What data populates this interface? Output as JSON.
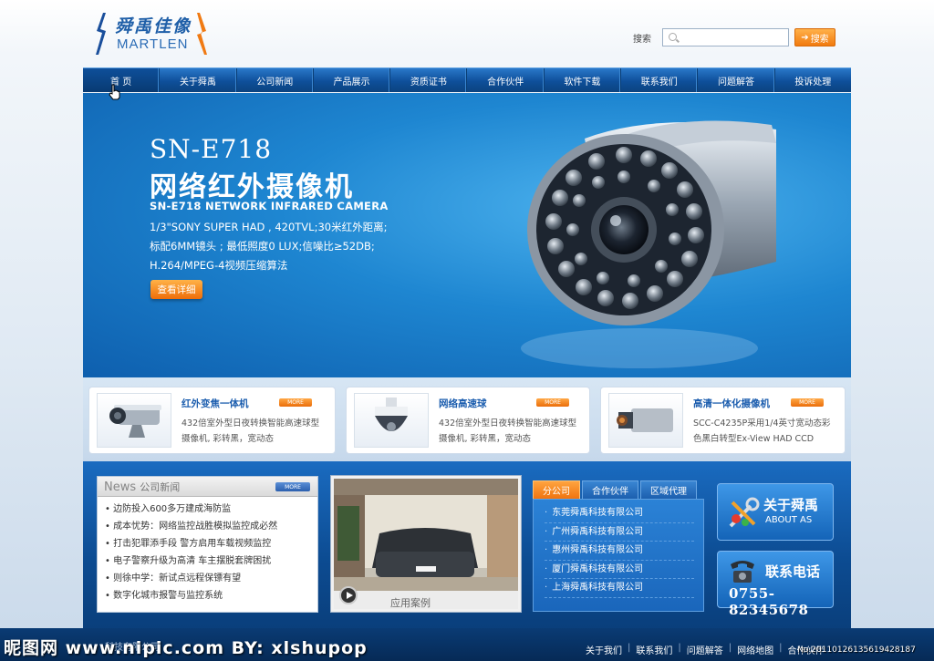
{
  "brand": {
    "name_cn": "舜禹佳像",
    "name_en": "MARTLEN"
  },
  "search": {
    "label": "搜索",
    "placeholder": "",
    "button": "搜索"
  },
  "nav": [
    {
      "label": "首 页"
    },
    {
      "label": "关于舜禹"
    },
    {
      "label": "公司新闻"
    },
    {
      "label": "产品展示"
    },
    {
      "label": "资质证书"
    },
    {
      "label": "合作伙伴"
    },
    {
      "label": "软件下载"
    },
    {
      "label": "联系我们"
    },
    {
      "label": "问题解答"
    },
    {
      "label": "投诉处理"
    }
  ],
  "banner": {
    "model": "SN-E718",
    "title": "网络红外摄像机",
    "title_en": "SN-E718 NETWORK INFRARED CAMERA",
    "desc": [
      "1/3\"SONY SUPER HAD , 420TVL;30米红外距离;",
      "标配6MM镜头 ; 最低照度0 LUX;信噪比≥52DB;",
      "H.264/MPEG-4视频压缩算法"
    ],
    "button": "查看详细"
  },
  "products": [
    {
      "title": "红外变焦一体机",
      "more": "MORE",
      "desc": "432倍室外型日夜转换智能高速球型摄像机, 彩转黑，宽动态"
    },
    {
      "title": "网络高速球",
      "more": "MORE",
      "desc": "432倍室外型日夜转换智能高速球型摄像机, 彩转黑，宽动态"
    },
    {
      "title": "高清一体化摄像机",
      "more": "MORE",
      "desc": "SCC-C4235P采用1/4英寸宽动态彩色黑白转型Ex-View HAD CCD"
    }
  ],
  "news": {
    "title_en": "News",
    "title_cn": "公司新闻",
    "more": "MORE",
    "items": [
      "边防投入600多万建成海防监",
      "成本忧势：网络监控战胜模拟监控成必然",
      "打击犯罪添手段 警方启用车载视频监控",
      "电子警察升级为高清 车主摆脱套牌困扰",
      "则徐中学：新试点远程保镖有望",
      "数字化城市报警与监控系统"
    ]
  },
  "case": {
    "caption": "应用案例"
  },
  "partners": {
    "tabs": [
      "分公司",
      "合作伙伴",
      "区域代理"
    ],
    "items": [
      "东莞舜禹科技有限公司",
      "广州舜禹科技有限公司",
      "惠州舜禹科技有限公司",
      "厦门舜禹科技有限公司",
      "上海舜禹科技有限公司"
    ]
  },
  "about": {
    "title": "关于舜禹",
    "subtitle": "ABOUT AS"
  },
  "contact": {
    "title": "联系电话",
    "phone": "0755-82345678"
  },
  "footer": {
    "copyright": "科技有限公司",
    "links": [
      "关于我们",
      "联系我们",
      "问题解答",
      "网络地图",
      "合作伙伴"
    ]
  },
  "watermark": {
    "text": "昵图网 www.nipic.com  BY: xlshupop",
    "id": "No:20110126135619428187"
  }
}
